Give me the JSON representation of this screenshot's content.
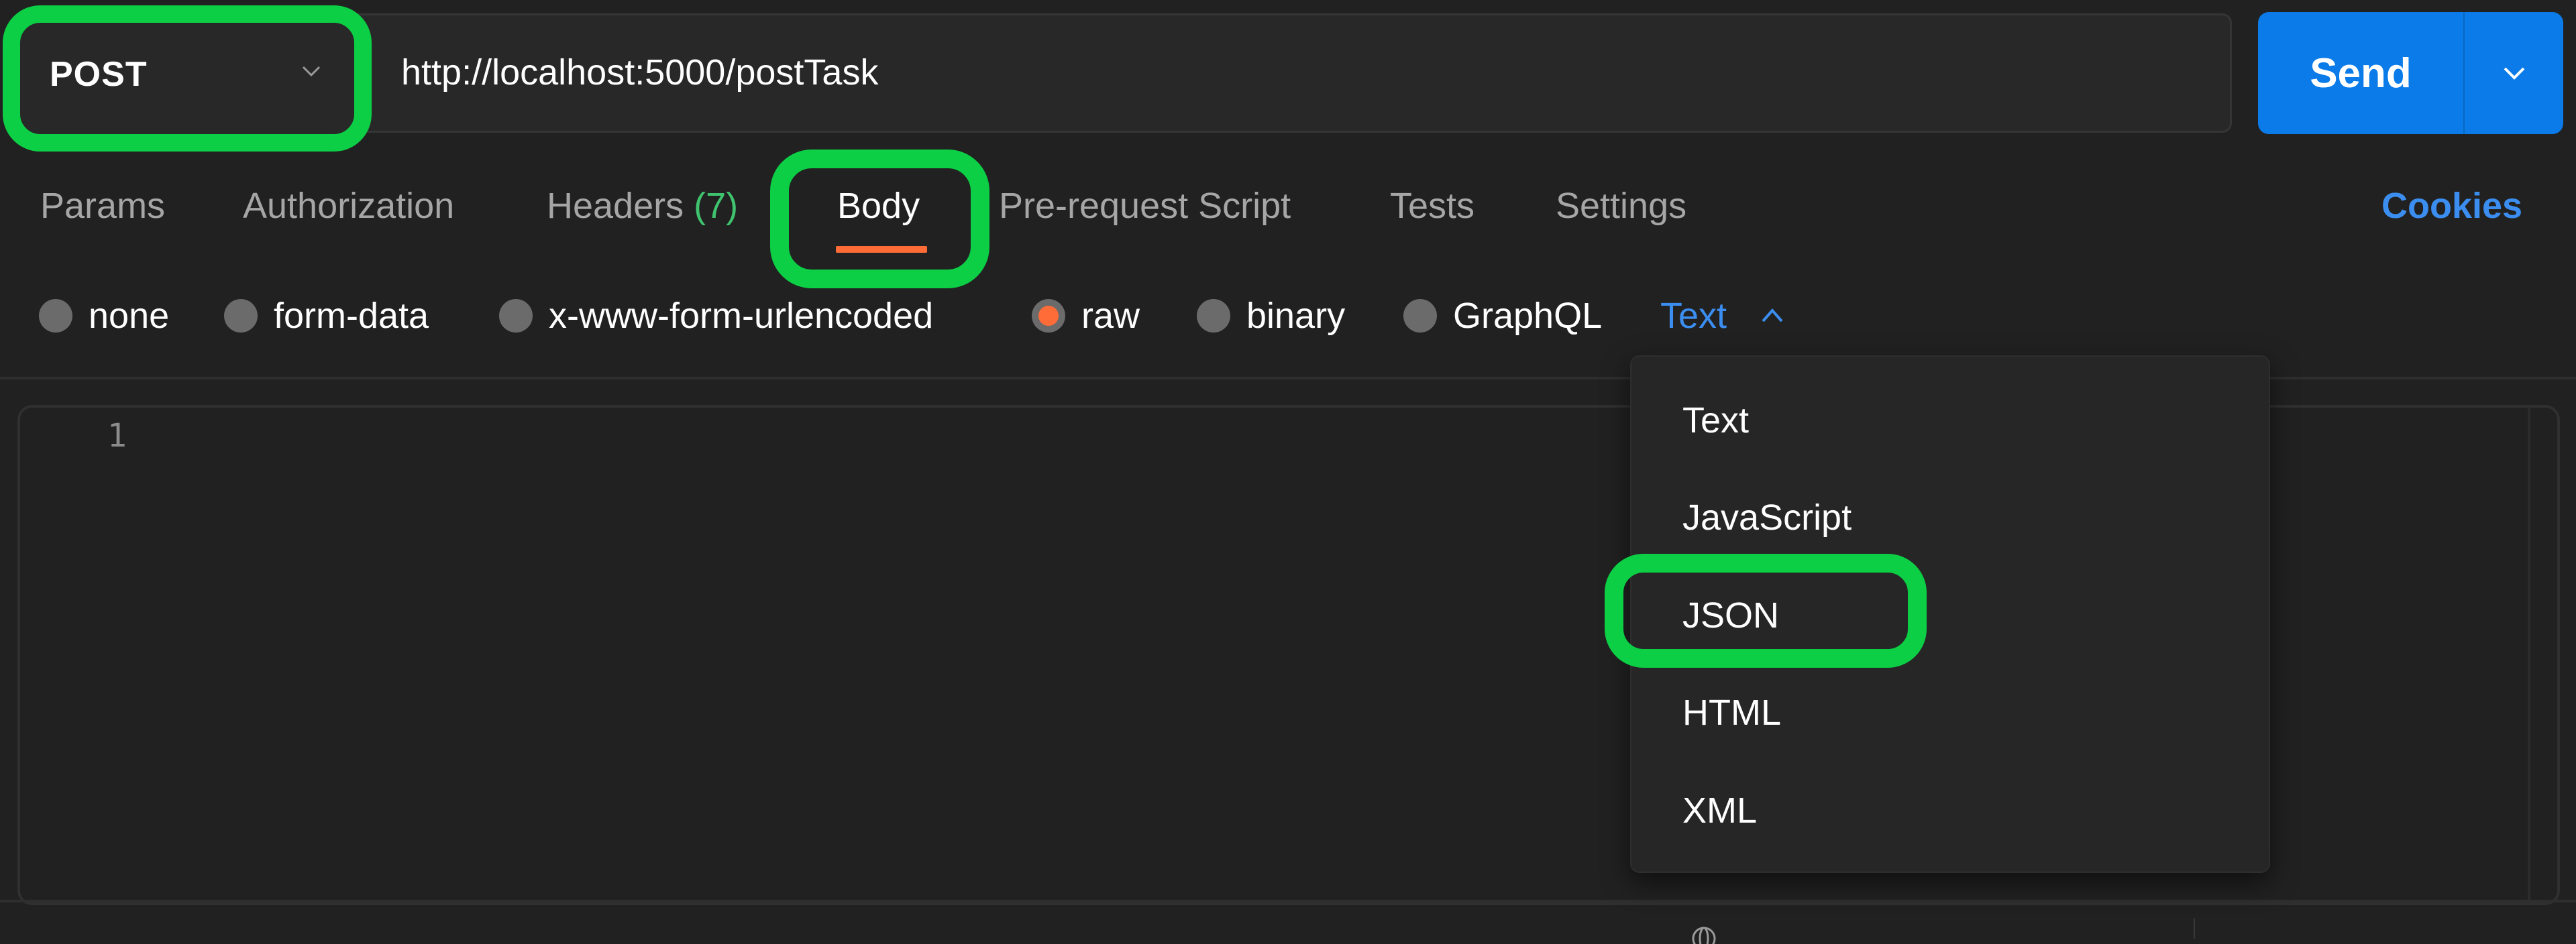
{
  "request": {
    "method": "POST",
    "url": "http://localhost:5000/postTask",
    "send_label": "Send"
  },
  "tabs": [
    {
      "label": "Params",
      "active": false
    },
    {
      "label": "Authorization",
      "active": false
    },
    {
      "label": "Headers",
      "count": "(7)",
      "active": false
    },
    {
      "label": "Body",
      "active": true
    },
    {
      "label": "Pre-request Script",
      "active": false
    },
    {
      "label": "Tests",
      "active": false
    },
    {
      "label": "Settings",
      "active": false
    }
  ],
  "cookies_label": "Cookies",
  "body_types": [
    {
      "label": "none",
      "checked": false
    },
    {
      "label": "form-data",
      "checked": false
    },
    {
      "label": "x-www-form-urlencoded",
      "checked": false
    },
    {
      "label": "raw",
      "checked": true
    },
    {
      "label": "binary",
      "checked": false
    },
    {
      "label": "GraphQL",
      "checked": false
    }
  ],
  "raw_language": {
    "selected": "Text",
    "options": [
      "Text",
      "JavaScript",
      "JSON",
      "HTML",
      "XML"
    ],
    "highlighted_option": "JSON"
  },
  "editor": {
    "line_numbers": [
      "1"
    ],
    "content": ""
  },
  "colors": {
    "accent_blue": "#0a7be8",
    "link_blue": "#3b8ef0",
    "tab_underline_orange": "#ff6c37",
    "annotation_green": "#0ccf45",
    "headers_count_green": "#3fc36e"
  }
}
